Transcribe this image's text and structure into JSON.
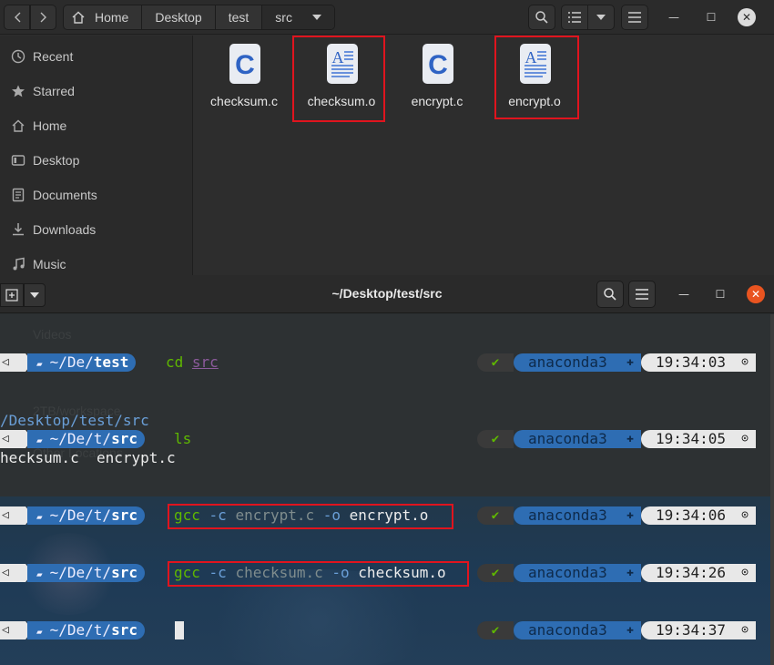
{
  "file_manager": {
    "breadcrumbs": [
      "Home",
      "Desktop",
      "test",
      "src"
    ],
    "sidebar": [
      {
        "label": "Recent",
        "icon": "clock-icon"
      },
      {
        "label": "Starred",
        "icon": "star-icon"
      },
      {
        "label": "Home",
        "icon": "home-icon"
      },
      {
        "label": "Desktop",
        "icon": "desktop-icon"
      },
      {
        "label": "Documents",
        "icon": "documents-icon"
      },
      {
        "label": "Downloads",
        "icon": "download-icon"
      },
      {
        "label": "Music",
        "icon": "music-icon"
      }
    ],
    "files": [
      {
        "name": "checksum.c",
        "icon": "c-source-file-icon"
      },
      {
        "name": "checksum.o",
        "icon": "object-file-icon"
      },
      {
        "name": "encrypt.c",
        "icon": "c-source-file-icon"
      },
      {
        "name": "encrypt.o",
        "icon": "object-file-icon"
      }
    ]
  },
  "terminal": {
    "title": "~/Desktop/test/src",
    "ghost_sidebar": [
      "Videos",
      "2TB/workspace",
      "Other Locations"
    ],
    "rows": [
      {
        "prompt_dim": "~/De/",
        "prompt_bold": "test",
        "cmd": [
          {
            "text": "cd",
            "cls": "c-green"
          },
          {
            "text": " ",
            "cls": "c-white"
          },
          {
            "text": "src",
            "cls": "c-purple"
          }
        ],
        "status": "✔",
        "env": "anaconda3",
        "time": "19:34:03"
      },
      {
        "prompt_dim": "~/De/t/",
        "prompt_bold": "src",
        "cmd": [
          {
            "text": "ls",
            "cls": "c-green"
          }
        ],
        "status": "✔",
        "env": "anaconda3",
        "time": "19:34:05"
      },
      {
        "prompt_dim": "~/De/t/",
        "prompt_bold": "src",
        "cmd": [
          {
            "text": "gcc",
            "cls": "c-green"
          },
          {
            "text": " -c ",
            "cls": "c-blue"
          },
          {
            "text": "encrypt.c",
            "cls": "c-dim"
          },
          {
            "text": " -o ",
            "cls": "c-blue"
          },
          {
            "text": "encrypt.o",
            "cls": "c-white"
          }
        ],
        "status": "✔",
        "env": "anaconda3",
        "time": "19:34:06"
      },
      {
        "prompt_dim": "~/De/t/",
        "prompt_bold": "src",
        "cmd": [
          {
            "text": "gcc",
            "cls": "c-green"
          },
          {
            "text": " -c ",
            "cls": "c-blue"
          },
          {
            "text": "checksum.c",
            "cls": "c-dim"
          },
          {
            "text": " -o ",
            "cls": "c-blue"
          },
          {
            "text": "checksum.o",
            "cls": "c-white"
          }
        ],
        "status": "✔",
        "env": "anaconda3",
        "time": "19:34:26"
      },
      {
        "prompt_dim": "~/De/t/",
        "prompt_bold": "src",
        "cmd": [],
        "status": "✔",
        "env": "anaconda3",
        "time": "19:34:37"
      }
    ],
    "path_echo": "/Desktop/test/src",
    "ls_output": "hecksum.c  encrypt.c",
    "colors": {
      "prompt_blue": "#2e6db3",
      "ok_green": "#5fb800",
      "highlight_red": "#e0141e",
      "close_orange": "#e95420"
    }
  }
}
